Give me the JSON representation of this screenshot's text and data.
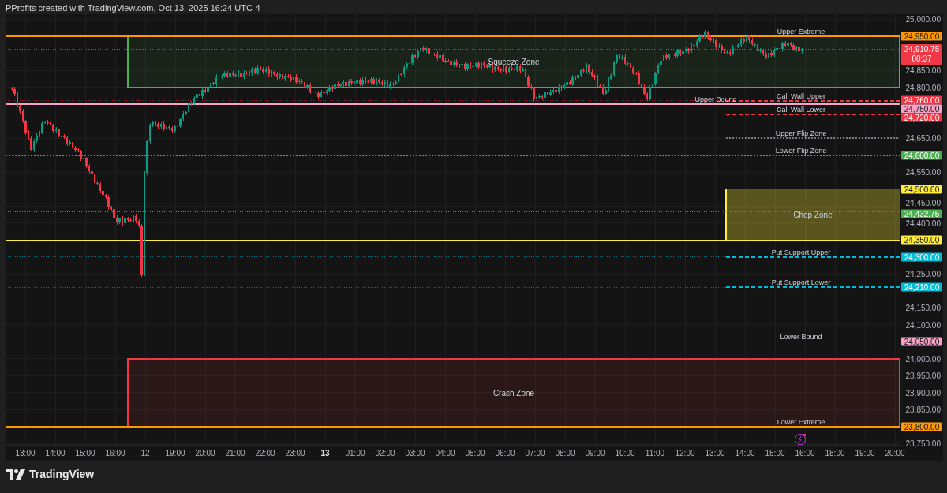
{
  "header": "PProfits created with TradingView.com, Oct 13, 2025 16:24 UTC-4",
  "zones": [
    {
      "label": "Squeeze Zone",
      "color": "#4caf50"
    },
    {
      "label": "Chop Zone",
      "color": "#ffeb3b",
      "tags": [
        "24,500.00",
        "24,350.00"
      ]
    },
    {
      "label": "Crash Zone",
      "color": "#f23645"
    }
  ],
  "levels": [
    {
      "label": "Upper Extreme",
      "color": "#ff9800",
      "kind": "solid",
      "tag": "24,950.00"
    },
    {
      "label": "Call Wall Upper",
      "color": "#f23645",
      "kind": "dashed",
      "tag": "24,760.00"
    },
    {
      "label": "Upper Bound",
      "color": "#f7a1c4",
      "kind": "solid",
      "tag": "24,750.00"
    },
    {
      "label": "Call Wall Lower",
      "color": "#f23645",
      "kind": "dashed",
      "tag": "24,720.00"
    },
    {
      "label": "Upper Flip Zone",
      "kind": "dotted"
    },
    {
      "label": "Lower Flip Zone",
      "color": "#4caf50",
      "kind": "dotted",
      "tag": "24,600.00"
    },
    {
      "label": "Put Support Upper",
      "color": "#00bcd4",
      "kind": "dashed",
      "tag": "24,300.00"
    },
    {
      "label": "Put Support Lower",
      "color": "#00bcd4",
      "kind": "dashed",
      "tag": "24,210.00"
    },
    {
      "label": "Lower Bound",
      "color": "#f7a1c4",
      "kind": "solid",
      "tag": "24,050.00"
    },
    {
      "label": "Lower Extreme",
      "color": "#ff9800",
      "kind": "solid",
      "tag": "23,800.00"
    }
  ],
  "last_price": {
    "price": "24,910.75",
    "countdown": "00:37",
    "color": "#f23645"
  },
  "prev_close": {
    "price": "24,432.75",
    "color": "#4caf50"
  },
  "price_axis": [
    "25,000.00",
    "24,850.00",
    "24,800.00",
    "24,650.00",
    "24,550.00",
    "24,450.00",
    "24,400.00",
    "24,250.00",
    "24,150.00",
    "24,100.00",
    "24,000.00",
    "23,950.00",
    "23,900.00",
    "23,850.00",
    "23,750.00"
  ],
  "time_axis": [
    {
      "label": "13:00",
      "bold": false
    },
    {
      "label": "14:00",
      "bold": false
    },
    {
      "label": "15:00",
      "bold": false
    },
    {
      "label": "16:00",
      "bold": false
    },
    {
      "label": "12",
      "bold": false
    },
    {
      "label": "19:00",
      "bold": false
    },
    {
      "label": "20:00",
      "bold": false
    },
    {
      "label": "21:00",
      "bold": false
    },
    {
      "label": "22:00",
      "bold": false
    },
    {
      "label": "23:00",
      "bold": false
    },
    {
      "label": "13",
      "bold": true
    },
    {
      "label": "01:00",
      "bold": false
    },
    {
      "label": "02:00",
      "bold": false
    },
    {
      "label": "03:00",
      "bold": false
    },
    {
      "label": "04:00",
      "bold": false
    },
    {
      "label": "05:00",
      "bold": false
    },
    {
      "label": "06:00",
      "bold": false
    },
    {
      "label": "07:00",
      "bold": false
    },
    {
      "label": "08:00",
      "bold": false
    },
    {
      "label": "09:00",
      "bold": false
    },
    {
      "label": "10:00",
      "bold": false
    },
    {
      "label": "11:00",
      "bold": false
    },
    {
      "label": "12:00",
      "bold": false
    },
    {
      "label": "13:00",
      "bold": false
    },
    {
      "label": "14:00",
      "bold": false
    },
    {
      "label": "15:00",
      "bold": false
    },
    {
      "label": "16:00",
      "bold": false
    },
    {
      "label": "18:00",
      "bold": false
    },
    {
      "label": "19:00",
      "bold": false
    },
    {
      "label": "20:00",
      "bold": false
    }
  ],
  "footer": {
    "brand": "TradingView"
  }
}
